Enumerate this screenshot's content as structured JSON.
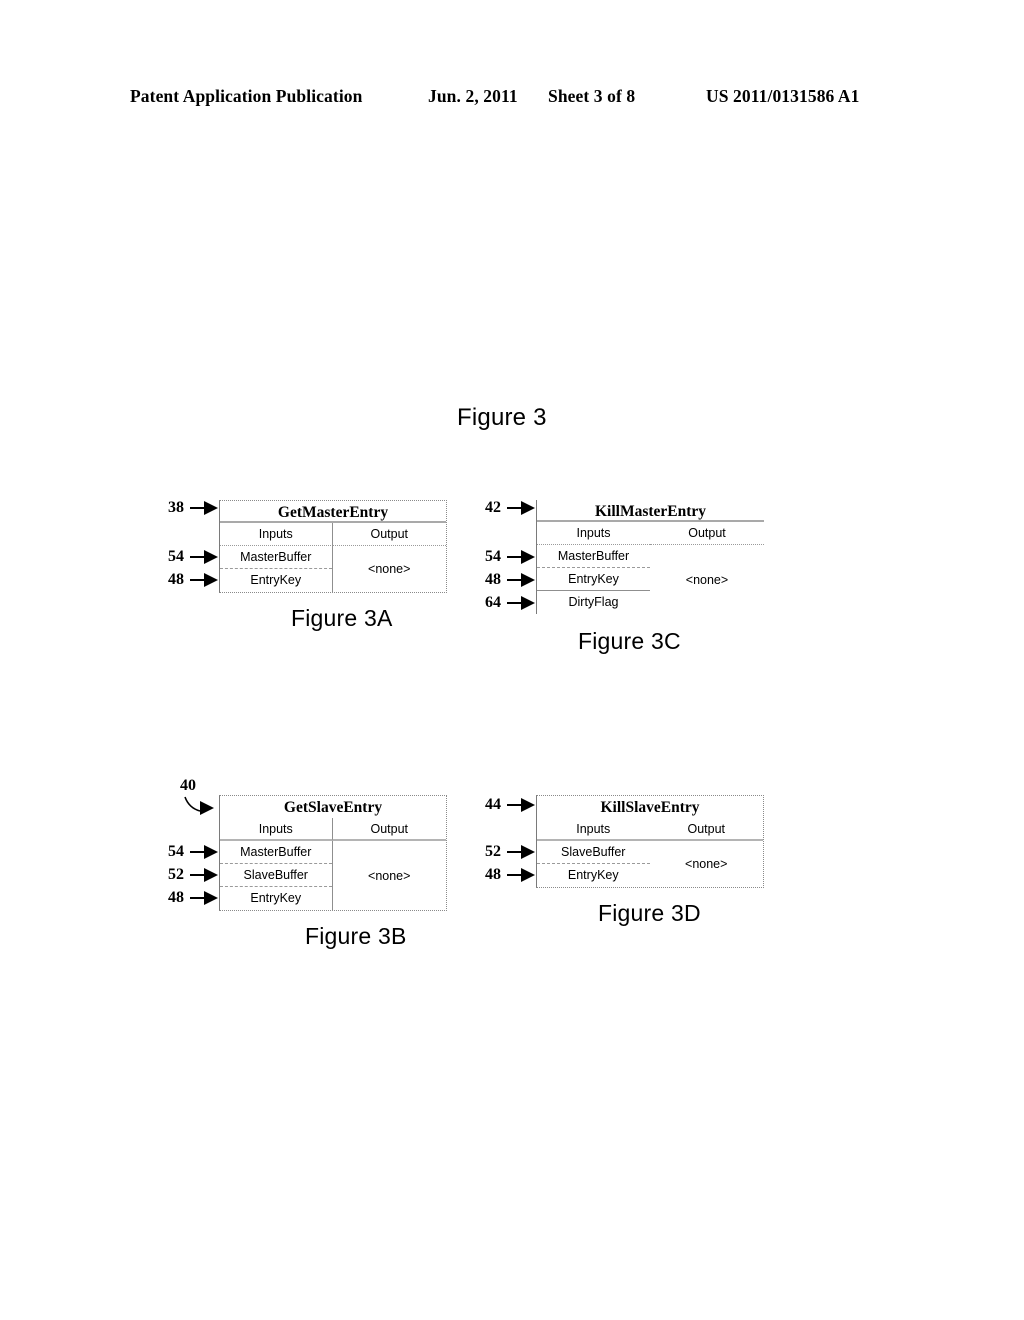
{
  "page_header": {
    "publication": "Patent Application Publication",
    "date": "Jun. 2, 2011",
    "sheet": "Sheet 3 of 8",
    "patent_number": "US 2011/0131586 A1"
  },
  "main_title": "Figure 3",
  "column_headers": {
    "inputs": "Inputs",
    "output": "Output"
  },
  "figures": [
    {
      "id": "3a",
      "caption": "Figure 3A",
      "title": "GetMasterEntry",
      "title_ref": "38",
      "output": "<none>",
      "inputs": [
        {
          "label": "MasterBuffer",
          "ref": "54"
        },
        {
          "label": "EntryKey",
          "ref": "48"
        }
      ]
    },
    {
      "id": "3c",
      "caption": "Figure 3C",
      "title": "KillMasterEntry",
      "title_ref": "42",
      "output": "<none>",
      "inputs": [
        {
          "label": "MasterBuffer",
          "ref": "54"
        },
        {
          "label": "EntryKey",
          "ref": "48"
        },
        {
          "label": "DirtyFlag",
          "ref": "64"
        }
      ]
    },
    {
      "id": "3b",
      "caption": "Figure 3B",
      "title": "GetSlaveEntry",
      "title_ref": "40",
      "output": "<none>",
      "inputs": [
        {
          "label": "MasterBuffer",
          "ref": "54"
        },
        {
          "label": "SlaveBuffer",
          "ref": "52"
        },
        {
          "label": "EntryKey",
          "ref": "48"
        }
      ]
    },
    {
      "id": "3d",
      "caption": "Figure 3D",
      "title": "KillSlaveEntry",
      "title_ref": "44",
      "output": "<none>",
      "inputs": [
        {
          "label": "SlaveBuffer",
          "ref": "52"
        },
        {
          "label": "EntryKey",
          "ref": "48"
        }
      ]
    }
  ]
}
